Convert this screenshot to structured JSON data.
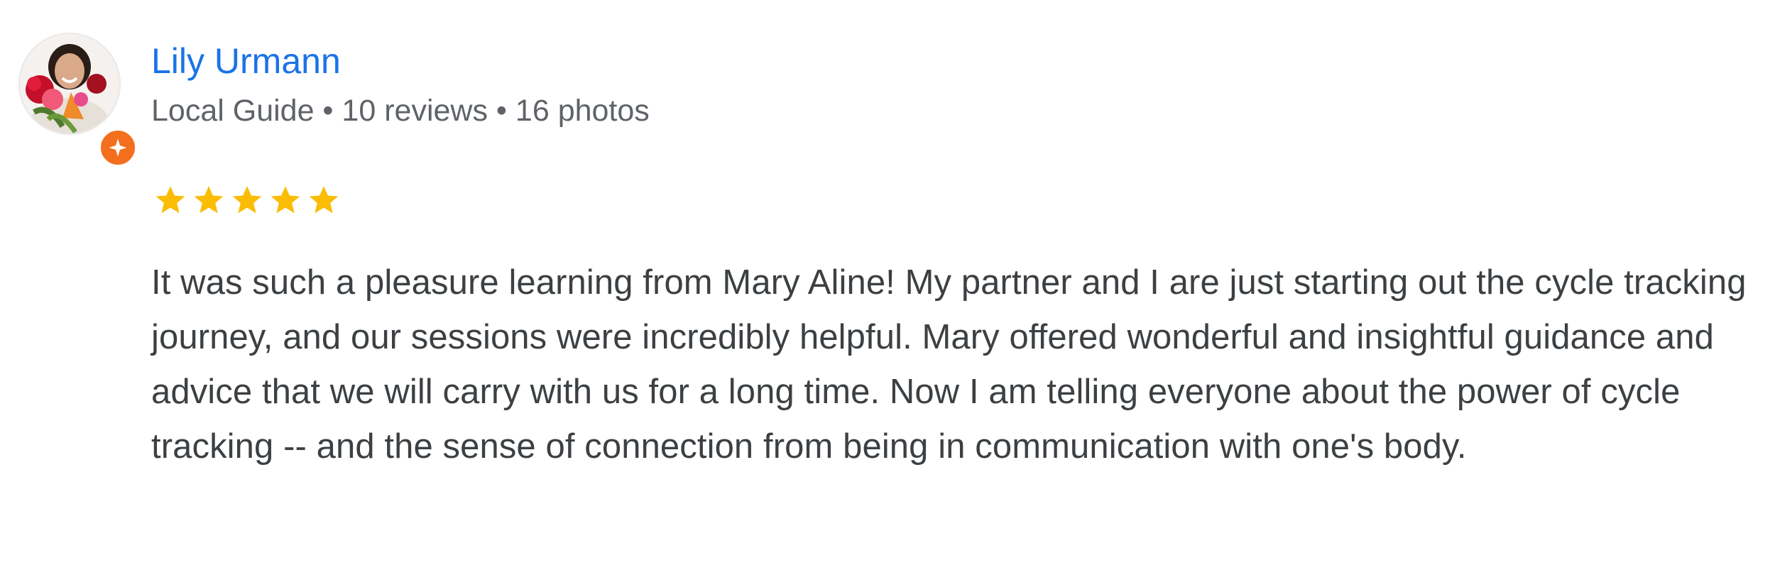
{
  "reviewer": {
    "name": "Lily Urmann",
    "meta": "Local Guide • 10 reviews • 16 photos",
    "avatar_icon": "person-with-flowers-avatar",
    "badge_icon": "local-guide-star-icon",
    "badge_color": "#f36f1d"
  },
  "rating": {
    "stars": 5,
    "max": 5,
    "star_color": "#fbbc04"
  },
  "review": {
    "text": "It was such a pleasure learning from Mary Aline! My partner and I are just starting out the cycle tracking journey, and our sessions were incredibly helpful. Mary offered wonderful and insightful guidance and advice that we will carry with us for a long time. Now I am telling everyone about the power of cycle tracking -- and the sense of connection from being in communication with one's body."
  },
  "colors": {
    "name_link": "#1a73e8",
    "meta_text": "#5f6368",
    "body_text": "#3c4043"
  }
}
